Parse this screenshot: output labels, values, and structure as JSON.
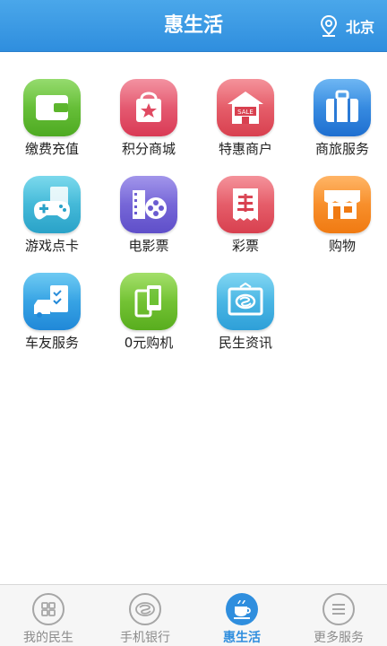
{
  "header": {
    "title": "惠生活",
    "location": "北京"
  },
  "services": [
    {
      "label": "缴费充值",
      "icon": "wallet-icon"
    },
    {
      "label": "积分商城",
      "icon": "shopping-bag-icon"
    },
    {
      "label": "特惠商户",
      "icon": "sale-store-icon"
    },
    {
      "label": "商旅服务",
      "icon": "suitcase-icon"
    },
    {
      "label": "游戏点卡",
      "icon": "gamepad-icon"
    },
    {
      "label": "电影票",
      "icon": "film-reel-icon"
    },
    {
      "label": "彩票",
      "icon": "lottery-ticket-icon"
    },
    {
      "label": "购物",
      "icon": "storefront-icon"
    },
    {
      "label": "车友服务",
      "icon": "car-checklist-icon"
    },
    {
      "label": "0元购机",
      "icon": "phone-icon"
    },
    {
      "label": "民生资讯",
      "icon": "news-frame-icon"
    }
  ],
  "tabs": [
    {
      "label": "我的民生",
      "icon": "grid-icon",
      "active": false
    },
    {
      "label": "手机银行",
      "icon": "bank-logo-icon",
      "active": false
    },
    {
      "label": "惠生活",
      "icon": "coffee-cup-icon",
      "active": true
    },
    {
      "label": "更多服务",
      "icon": "menu-icon",
      "active": false
    }
  ]
}
